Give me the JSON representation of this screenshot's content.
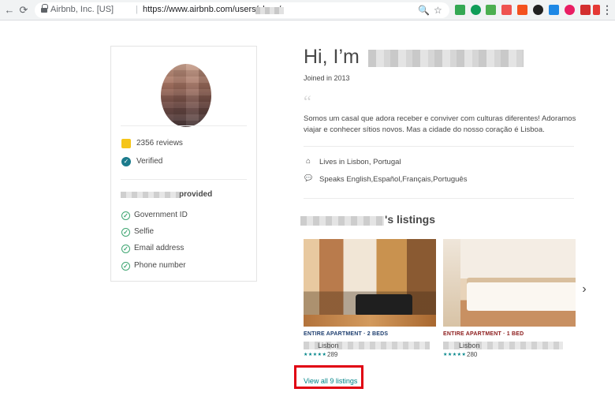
{
  "browser": {
    "site_identity": "Airbnb, Inc. [US]",
    "separator": "|",
    "url": "https://www.airbnb.com/users/show/",
    "back_glyph": "←",
    "forward_glyph": "→",
    "reload_glyph": "⟳",
    "zoom_glyph": "🔍",
    "bookmark_glyph": "☆",
    "menu_glyph": "⋮",
    "extension_colors": [
      "#34a853",
      "#0f9d58",
      "#4caf50",
      "#ef5350",
      "#f4511e",
      "#212121",
      "#1e88e5",
      "#e91e63",
      "#d32f2f",
      "#e53935"
    ]
  },
  "profile": {
    "reviews": "2356 reviews",
    "verified": "Verified",
    "provided_suffix": "provided",
    "verifications": [
      "Government ID",
      "Selfie",
      "Email address",
      "Phone number"
    ],
    "check_glyph": "✓"
  },
  "main": {
    "greeting": "Hi, I’m",
    "joined": "Joined in 2013",
    "quote_glyph": "“",
    "about": "Somos um casal que adora receber e conviver com culturas diferentes! Adoramos viajar e conhecer sítios novos. Mas a cidade do nosso coração é Lisboa.",
    "lives_in": "Lives in Lisbon, Portugal",
    "speaks": "Speaks English,Español,Français,Português",
    "home_glyph": "⌂",
    "speech_glyph": "💬",
    "listings_heading_suffix": "'s listings",
    "next_glyph": "›",
    "view_all": "View all 9 listings"
  },
  "listings": [
    {
      "type": "ENTIRE APARTMENT · 2 BEDS",
      "type_color": "#1c3d6e",
      "location": "Lisbon",
      "stars": "★★★★★",
      "reviews": "289"
    },
    {
      "type": "ENTIRE APARTMENT · 1 BED",
      "type_color": "#8b1a1a",
      "location": "Lisbon",
      "stars": "★★★★★",
      "reviews": "280"
    }
  ]
}
